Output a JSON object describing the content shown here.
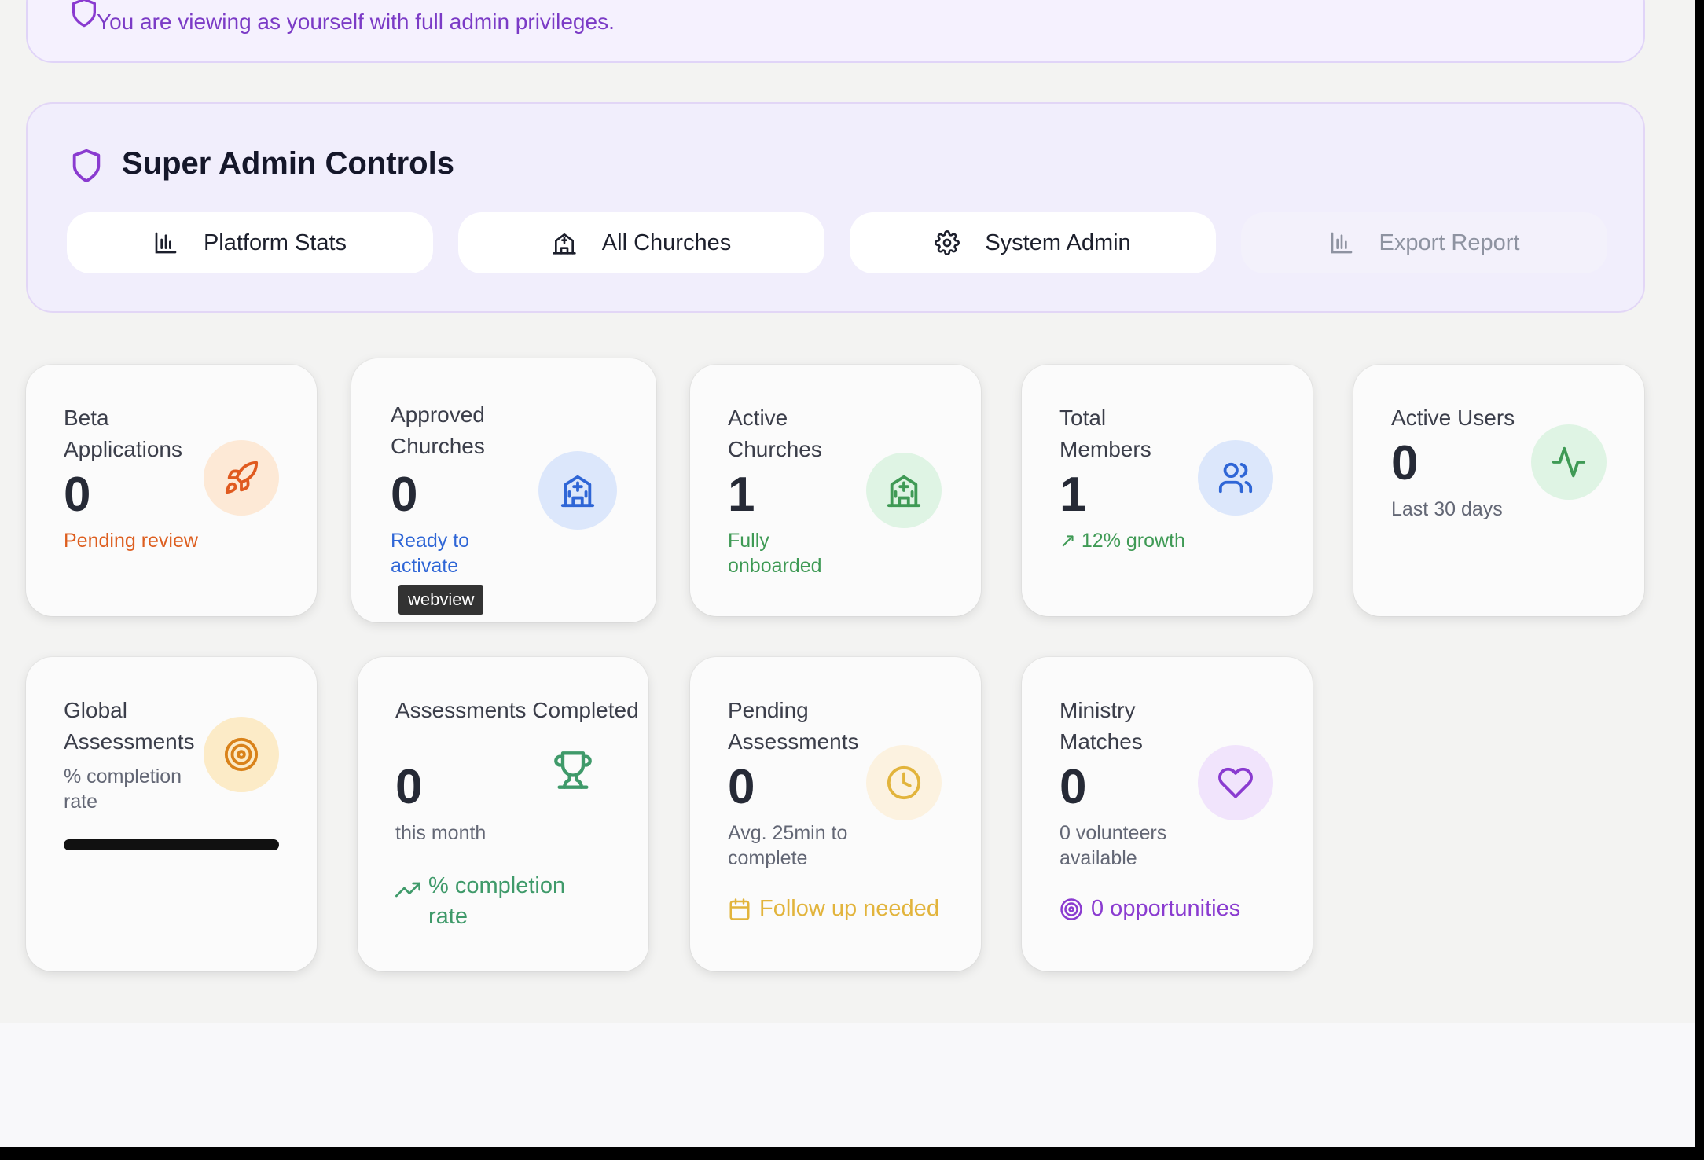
{
  "banner": {
    "text": "You are viewing as yourself with full admin privileges."
  },
  "admin_controls": {
    "title": "Super Admin Controls",
    "buttons": [
      {
        "label": "Platform Stats",
        "icon": "bar-chart-icon"
      },
      {
        "label": "All Churches",
        "icon": "church-icon"
      },
      {
        "label": "System Admin",
        "icon": "gear-icon"
      },
      {
        "label": "Export Report",
        "icon": "bar-chart-icon",
        "disabled": true
      }
    ]
  },
  "stats_row1": [
    {
      "label": "Beta Applications",
      "value": "0",
      "sub": "Pending review",
      "sub_color": "#dd5e1f",
      "icon": "rocket-icon",
      "icon_bg": "#fde9d6",
      "icon_color": "#e05a1f"
    },
    {
      "label": "Approved Churches",
      "value": "0",
      "sub": "Ready to activate",
      "sub_color": "#2f66d6",
      "icon": "hospital-icon",
      "icon_bg": "#dce7fb",
      "icon_color": "#2f66d6"
    },
    {
      "label": "Active Churches",
      "value": "1",
      "sub": "Fully onboarded",
      "sub_color": "#3f9a55",
      "icon": "hospital-icon",
      "icon_bg": "#dff4e4",
      "icon_color": "#3f9a55"
    },
    {
      "label": "Total Members",
      "value": "1",
      "sub": "↗ 12% growth",
      "sub_color": "#3f9a55",
      "icon": "users-icon",
      "icon_bg": "#dce7fb",
      "icon_color": "#2f66d6"
    },
    {
      "label": "Active Users",
      "value": "0",
      "sub": "Last 30 days",
      "sub_color": "#636775",
      "icon": "activity-icon",
      "icon_bg": "#dff4e4",
      "icon_color": "#3f9a55"
    }
  ],
  "tooltip": "webview",
  "stats_row2": [
    {
      "label": "Global Assessments",
      "value": "",
      "sub": "% completion rate",
      "sub_color": "#636775",
      "icon": "target-icon",
      "icon_bg": "#fcebc7",
      "icon_color": "#d9821a"
    },
    {
      "label": "Assessments Completed",
      "value": "0",
      "sub": "this month",
      "sub_color": "#636775",
      "footer": "% completion rate",
      "footer_color": "#3f9a6a",
      "icon": "trophy-icon",
      "icon_color": "#3f9a6a"
    },
    {
      "label": "Pending Assessments",
      "value": "0",
      "sub": "Avg. 25min to complete",
      "sub_color": "#636775",
      "footer": "Follow up needed",
      "footer_color": "#e2b43c",
      "icon": "clock-icon",
      "icon_bg": "#fcf2e0",
      "icon_color": "#e2b43c"
    },
    {
      "label": "Ministry Matches",
      "value": "0",
      "sub": "0 volunteers available",
      "sub_color": "#636775",
      "footer": "0 opportunities",
      "footer_color": "#8a3bd0",
      "icon": "heart-icon",
      "icon_bg": "#f1e4fc",
      "icon_color": "#8a3bd0"
    }
  ]
}
